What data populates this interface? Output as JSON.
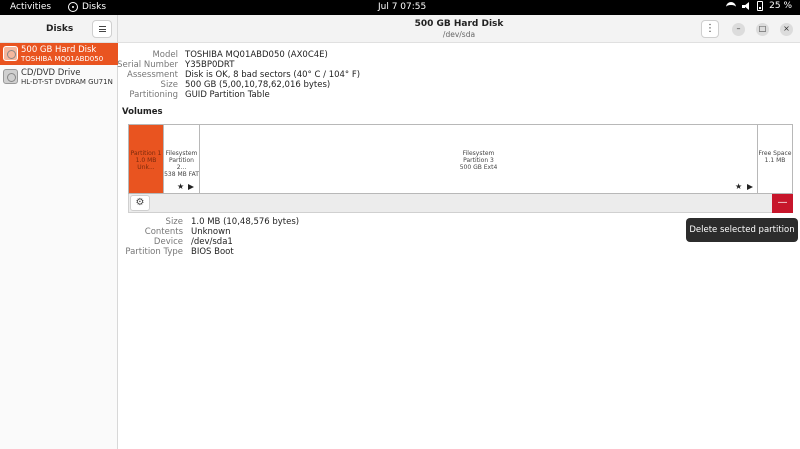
{
  "topbar": {
    "activities": "Activities",
    "app_name": "Disks",
    "clock": "Jul 7  07:55",
    "battery": "25 %"
  },
  "sidebar": {
    "title": "Disks",
    "drives": [
      {
        "name": "500 GB Hard Disk",
        "model": "TOSHIBA MQ01ABD050",
        "selected": true
      },
      {
        "name": "CD/DVD Drive",
        "model": "HL-DT-ST DVDRAM GU71N",
        "selected": false
      }
    ]
  },
  "header": {
    "title": "500 GB Hard Disk",
    "subtitle": "/dev/sda",
    "kebab": "⋮",
    "minimize": "–",
    "maximize": "□",
    "close": "×"
  },
  "disk_info": [
    {
      "label": "Model",
      "value": "TOSHIBA MQ01ABD050 (AX0C4E)"
    },
    {
      "label": "Serial Number",
      "value": "Y35BP0DRT"
    },
    {
      "label": "Assessment",
      "value": "Disk is OK, 8 bad sectors (40° C / 104° F)"
    },
    {
      "label": "Size",
      "value": "500 GB (5,00,10,78,62,016 bytes)"
    },
    {
      "label": "Partitioning",
      "value": "GUID Partition Table"
    }
  ],
  "volumes": {
    "title": "Volumes",
    "partitions": [
      {
        "line1": "Partition 1",
        "line2": "1.0 MB Unk...",
        "selected": true
      },
      {
        "line1": "Filesystem",
        "line2": "Partition 2...",
        "line3": "538 MB FAT",
        "selected": false
      },
      {
        "line1": "Filesystem",
        "line2": "Partition 3",
        "line3": "500 GB Ext4",
        "selected": false
      },
      {
        "line1": "Free Space",
        "line2": "1.1 MB",
        "selected": false
      }
    ],
    "star": "★",
    "gear": "⚙",
    "delete": "—"
  },
  "tooltip": "Delete selected partition",
  "partition_info": [
    {
      "label": "Size",
      "value": "1.0 MB (10,48,576 bytes)"
    },
    {
      "label": "Contents",
      "value": "Unknown"
    },
    {
      "label": "Device",
      "value": "/dev/sda1"
    },
    {
      "label": "Partition Type",
      "value": "BIOS Boot"
    }
  ]
}
